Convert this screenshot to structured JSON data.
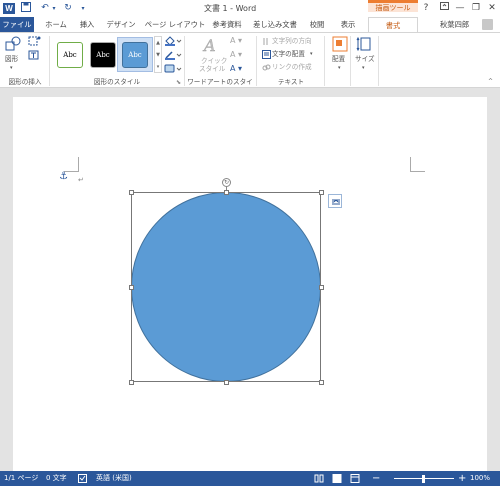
{
  "titlebar": {
    "title": "文書 1 - Word",
    "contextual_header": "描画ツール",
    "help": "?",
    "minimize": "—",
    "restore": "❐",
    "close": "✕"
  },
  "tabs": {
    "file": "ファイル",
    "home": "ホーム",
    "insert": "挿入",
    "design": "デザイン",
    "page_layout": "ページ レイアウト",
    "references": "参考資料",
    "mailings": "差し込み文書",
    "review": "校閲",
    "view": "表示",
    "format": "書式",
    "user": "秋葉四郎"
  },
  "ribbon": {
    "insert_shapes": {
      "shapes_button": "図形",
      "group_label": "図形の挿入"
    },
    "shape_styles": {
      "samples": [
        "Abc",
        "Abc",
        "Abc"
      ],
      "group_label": "図形のスタイル"
    },
    "wordart": {
      "quick_styles": "クイック",
      "quick_styles_2": "スタイル",
      "group_label": "ワードアートのスタイル"
    },
    "text": {
      "direction": "文字列の方向",
      "align": "文字の配置",
      "link": "リンクの作成",
      "group_label": "テキスト"
    },
    "arrange": {
      "position": "配置"
    },
    "size": {
      "size": "サイズ"
    }
  },
  "statusbar": {
    "page": "1/1 ページ",
    "words": "0 文字",
    "language": "英語 (米国)",
    "zoom": "100%"
  },
  "colors": {
    "accent": "#2b579a",
    "shape_fill": "#5b9bd5",
    "contextual": "#ed7d31"
  }
}
